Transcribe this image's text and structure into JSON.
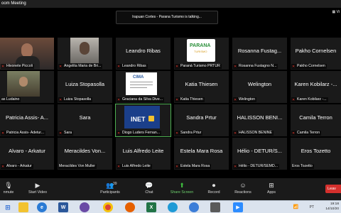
{
  "window": {
    "title": "oom Meeting",
    "view_label": "Vi"
  },
  "active_speaker": "Irapuan Cortes - Parana Turismo is talking...",
  "participants": {
    "row1": [
      {
        "center": "",
        "label": "Hivonete Piccoli"
      },
      {
        "center": "",
        "label": "Angelita Maria de Bri..."
      },
      {
        "center": "Leandro Ribas",
        "label": "Leandro Ribas"
      },
      {
        "center": "",
        "label": "Paraná Turismo PRTUR"
      },
      {
        "center": "Rosanna Fustag...",
        "label": "Rosanna Fustagno N..."
      },
      {
        "center": "Pakho Cornelsen",
        "label": "Pakho Cornelsen"
      }
    ],
    "row2": [
      {
        "center": "",
        "label": "as Ludaino"
      },
      {
        "center": "Luiza Stopasolla",
        "label": "Luiza Stopasolla"
      },
      {
        "center": "",
        "label": "Graciana da Silva Dive..."
      },
      {
        "center": "Katia Thiesen",
        "label": "Katia Thiesen"
      },
      {
        "center": "Welington",
        "label": "Welington"
      },
      {
        "center": "Karen Kobilarz -...",
        "label": "Karen Kobilarz -..."
      }
    ],
    "row3": [
      {
        "center": "Patricia Assis- A...",
        "label": "Patricia Assis- Adetur..."
      },
      {
        "center": "Sara",
        "label": "Sara"
      },
      {
        "center": "",
        "label": "Diogo Luders Fernan..."
      },
      {
        "center": "Sandra Prtur",
        "label": "Sandra Prtur"
      },
      {
        "center": "HALISSON BENI...",
        "label": "HALISSON BENINE"
      },
      {
        "center": "Camila Terron",
        "label": "Camila Terron"
      }
    ],
    "row4": [
      {
        "center": "Alvaro - Arkatur",
        "label": "Alvaro - Arkatur"
      },
      {
        "center": "Meracildes Von...",
        "label": "Meracildes Von Muller"
      },
      {
        "center": "Luis Alfredo Leite",
        "label": "Luis Alfredo Leite"
      },
      {
        "center": "Estela Mara Rosa",
        "label": "Estela Mara Rosa"
      },
      {
        "center": "Hélio - DETUR/S...",
        "label": "Hélio - DETUR/SEMD..."
      },
      {
        "center": "Eros Tozetto",
        "label": "Eros Tozetto"
      }
    ]
  },
  "logos": {
    "parana": "PARANA",
    "parana_sub": "TURISMO",
    "cima": "CIMA",
    "inet": "INET"
  },
  "toolbar": {
    "unmute": "nmute",
    "start_video": "Start Video",
    "participants": "Participants",
    "participants_count": "39",
    "chat": "Chat",
    "share_screen": "Share Screen",
    "record": "Record",
    "reactions": "Reactions",
    "apps": "Apps",
    "leave": "Leav"
  },
  "taskbar": {
    "time": "19:18",
    "date": "14/10/20",
    "lang": "PT"
  }
}
